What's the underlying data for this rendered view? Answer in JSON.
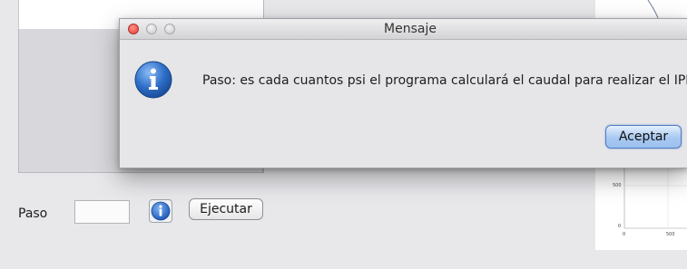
{
  "dialog": {
    "title": "Mensaje",
    "message": "Paso: es cada cuantos psi el programa calculará el caudal para realizar el IPR",
    "ok_label": "Aceptar",
    "icon": "info-icon"
  },
  "form": {
    "paso_label": "Paso",
    "paso_value": "",
    "run_label": "Ejecutar",
    "help_icon": "info-icon"
  },
  "chart": {
    "y_ticks": [
      "500",
      "0"
    ],
    "x_ticks": [
      "0",
      "500"
    ]
  },
  "colors": {
    "accent": "#9cc0f0",
    "close_button": "#e03e33",
    "info_icon": "#2f6fc8"
  }
}
